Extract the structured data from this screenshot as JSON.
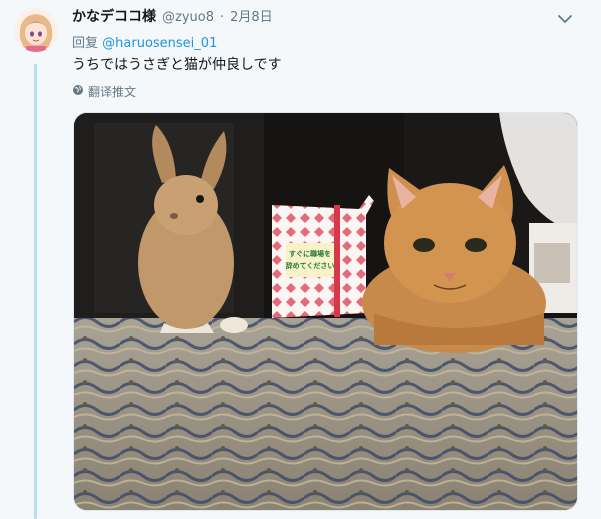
{
  "tweet": {
    "display_name": "かなデココ様",
    "handle": "@zyuo8",
    "separator": "·",
    "date": "2月8日",
    "reply_prefix": "回复",
    "reply_mention": "@haruosensei_01",
    "text": "うちではうさぎと猫が仲良しです",
    "translate_label": "翻译推文"
  },
  "photo": {
    "box_text_line1": "すぐに職場を",
    "box_text_line2": "辞めてください"
  },
  "icons": {
    "more": "chevron-down-icon",
    "translate": "globe-icon",
    "avatar": "avatar"
  },
  "colors": {
    "link": "#1b95e0",
    "muted": "#657786",
    "thread": "#b3dff5"
  }
}
